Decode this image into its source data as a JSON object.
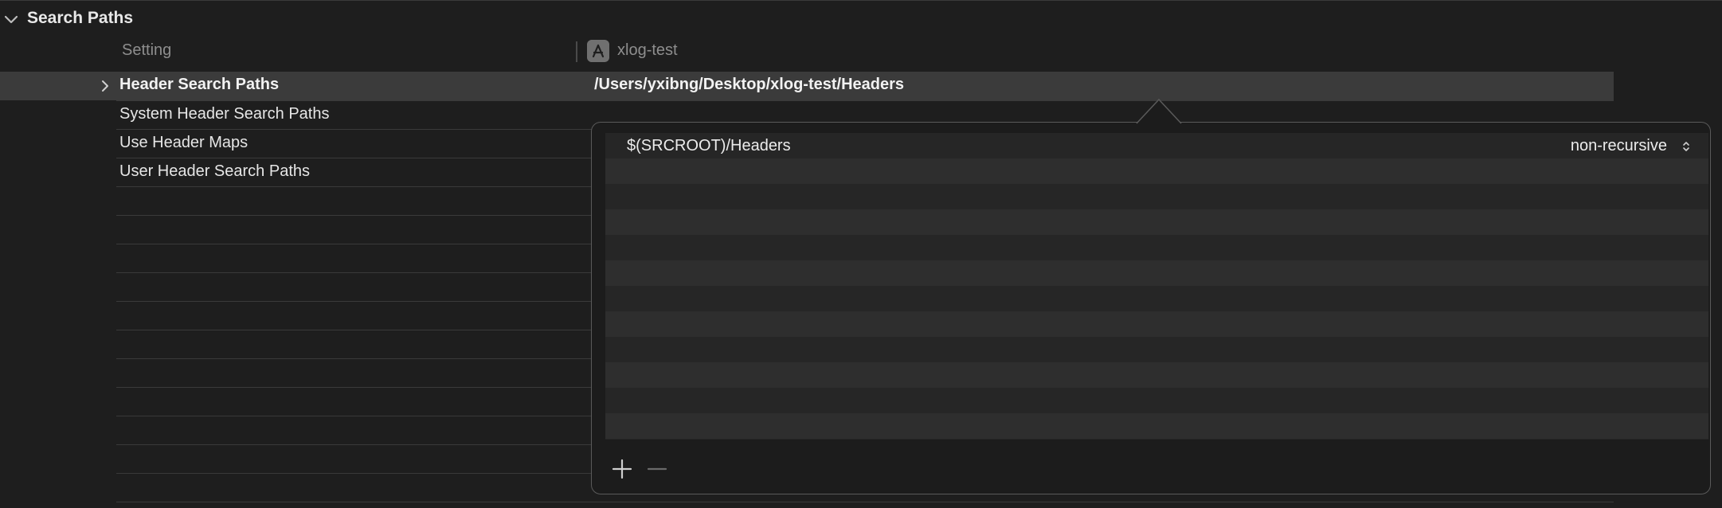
{
  "section": {
    "title": "Search Paths"
  },
  "columns": {
    "setting_label": "Setting",
    "target_label": "xlog-test"
  },
  "rows": [
    {
      "label": "Header Search Paths",
      "value": "/Users/yxibng/Desktop/xlog-test/Headers",
      "selected": true
    },
    {
      "label": "System Header Search Paths",
      "value": ""
    },
    {
      "label": "Use Header Maps",
      "value": ""
    },
    {
      "label": "User Header Search Paths",
      "value": ""
    }
  ],
  "popover": {
    "entries": [
      {
        "path": "$(SRCROOT)/Headers",
        "recursion": "non-recursive"
      }
    ]
  },
  "icons": {
    "section_toggle": "chevron-down-icon",
    "row_expand": "chevron-right-icon",
    "target": "app-target-icon",
    "stepper": "updown-stepper-icon",
    "add": "plus-icon",
    "remove": "minus-icon"
  },
  "colors": {
    "background": "#1e1e1e",
    "selected_row": "#3b3b3b",
    "popover_bg": "#262626"
  }
}
